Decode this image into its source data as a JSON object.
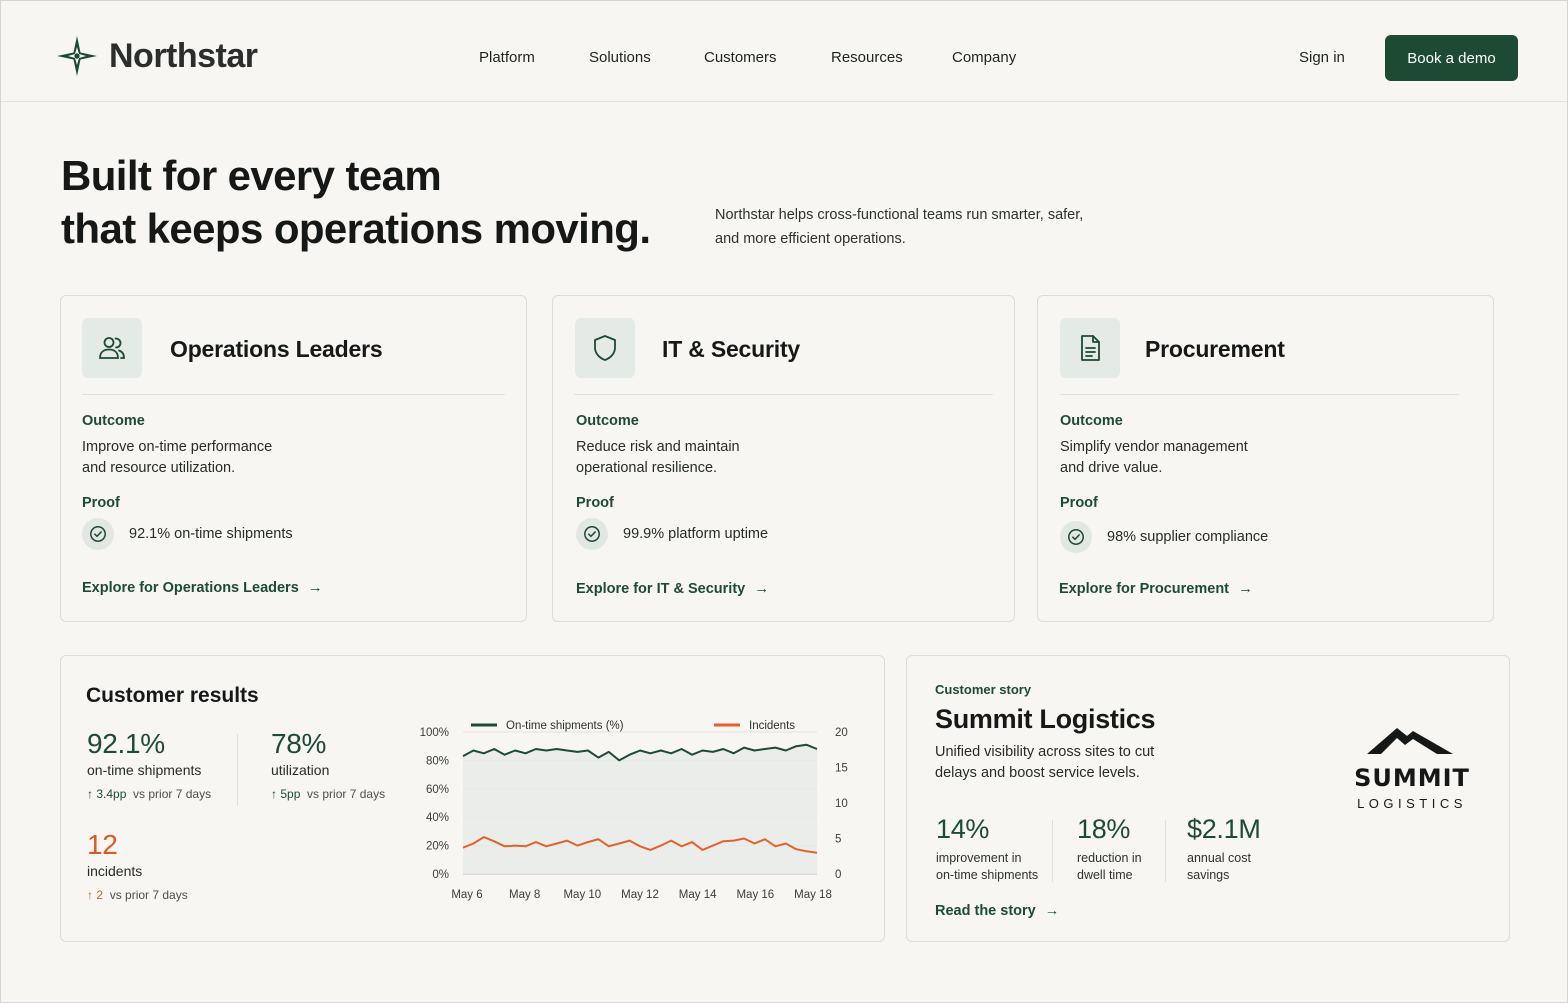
{
  "brand": {
    "name": "Northstar"
  },
  "nav": {
    "items": [
      "Platform",
      "Solutions",
      "Customers",
      "Resources",
      "Company"
    ],
    "sign_in": "Sign in",
    "cta": "Book a demo"
  },
  "hero": {
    "title_line1": "Built for every team",
    "title_line2": "that keeps operations moving.",
    "subtitle": "Northstar helps cross-functional teams run smarter, safer, and more efficient operations."
  },
  "teams": [
    {
      "title": "Operations Leaders",
      "icon": "users-icon",
      "outcome_label": "Outcome",
      "outcome_line1": "Improve on-time performance",
      "outcome_line2": "and resource utilization.",
      "proof_label": "Proof",
      "proof": "92.1% on-time shipments",
      "link": "Explore for Operations Leaders"
    },
    {
      "title": "IT & Security",
      "icon": "shield-icon",
      "outcome_label": "Outcome",
      "outcome_line1": "Reduce risk and maintain",
      "outcome_line2": "operational resilience.",
      "proof_label": "Proof",
      "proof": "99.9% platform uptime",
      "link": "Explore for IT & Security"
    },
    {
      "title": "Procurement",
      "icon": "document-icon",
      "outcome_label": "Outcome",
      "outcome_line1": "Simplify vendor management",
      "outcome_line2": "and drive value.",
      "proof_label": "Proof",
      "proof": "98% supplier compliance",
      "link": "Explore for Procurement"
    }
  ],
  "results": {
    "title": "Customer results",
    "metrics": [
      {
        "value": "92.1%",
        "label": "on-time shipments",
        "delta": "3.4pp",
        "delta_note": "vs prior 7 days"
      },
      {
        "value": "78%",
        "label": "utilization",
        "delta": "5pp",
        "delta_note": "vs prior 7 days"
      },
      {
        "value": "12",
        "label": "incidents",
        "delta": "2",
        "delta_note": "vs prior 7 days"
      }
    ]
  },
  "chart_data": {
    "type": "line",
    "title": "",
    "x": [
      "May 6",
      "",
      "May 7",
      "",
      "May 8",
      "",
      "May 9",
      "",
      "May 10",
      "",
      "May 11",
      "",
      "May 12",
      "",
      "May 13",
      "",
      "May 14",
      "",
      "May 15",
      "",
      "May 16",
      "",
      "May 17",
      "",
      "May 18"
    ],
    "x_ticks": [
      "May 6",
      "May 8",
      "May 10",
      "May 12",
      "May 14",
      "May 16",
      "May 18"
    ],
    "y_left_ticks": [
      "0%",
      "20%",
      "40%",
      "60%",
      "80%",
      "100%"
    ],
    "y_right_ticks": [
      "0",
      "5",
      "10",
      "15",
      "20"
    ],
    "ylim_left": [
      0,
      100
    ],
    "ylim_right": [
      0,
      20
    ],
    "legend_position": "top",
    "grid": "horizontal",
    "series": [
      {
        "name": "On-time shipments (%)",
        "axis": "left",
        "color": "#1d4b34",
        "values": [
          83,
          87,
          85,
          88,
          84,
          87,
          85,
          88,
          87,
          88,
          87,
          86,
          87,
          82,
          86,
          80,
          84,
          87,
          85,
          87,
          85,
          88,
          84,
          87,
          86,
          88,
          85,
          89,
          87,
          88,
          89,
          87,
          90,
          91,
          88
        ]
      },
      {
        "name": "Incidents",
        "axis": "right",
        "color": "#e2622b",
        "values": [
          3.7,
          4.3,
          5.2,
          4.6,
          3.9,
          4.0,
          3.9,
          4.5,
          3.9,
          4.3,
          4.7,
          4.0,
          4.5,
          4.9,
          3.9,
          4.3,
          4.7,
          3.9,
          3.4,
          4.0,
          4.7,
          3.9,
          4.5,
          3.4,
          4.0,
          4.6,
          4.7,
          5.0,
          4.3,
          4.9,
          3.9,
          4.3,
          3.5,
          3.2,
          3.0
        ]
      }
    ]
  },
  "story": {
    "eyebrow": "Customer story",
    "title": "Summit Logistics",
    "description": "Unified visibility across sites to cut delays and boost service levels.",
    "metrics": [
      {
        "value": "14%",
        "label": "improvement in\non-time shipments"
      },
      {
        "value": "18%",
        "label": "reduction in\ndwell time"
      },
      {
        "value": "$2.1M",
        "label": "annual cost\nsavings"
      }
    ],
    "link": "Read the story",
    "logo_word": "SUMMIT",
    "logo_sub": "LOGISTICS"
  },
  "colors": {
    "brand_green": "#1c4a33",
    "accent_orange": "#e2622b",
    "background": "#f7f6f3"
  }
}
